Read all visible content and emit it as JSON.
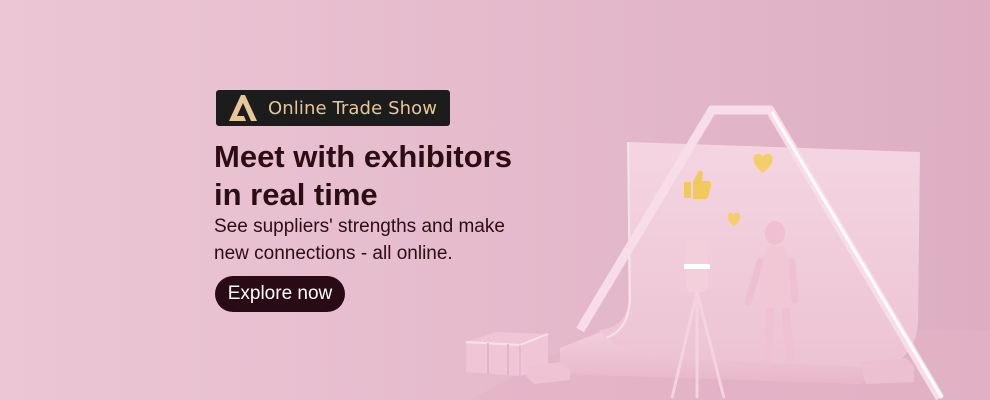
{
  "badge": {
    "label": "Online Trade Show",
    "logo_icon": "alibaba-a-logo-icon"
  },
  "headline": {
    "line1": "Meet with exhibitors",
    "line2": "in real time"
  },
  "subtext": {
    "line1": "See suppliers' strengths and make",
    "line2": "new connections - all online."
  },
  "cta": {
    "label": "Explore now"
  },
  "illustration": {
    "icons": [
      "thumbs-up-icon",
      "heart-icon",
      "camera-on-tripod",
      "figure-mannequin",
      "photo-backdrop",
      "boxes"
    ]
  },
  "colors": {
    "background": "#e6bccd",
    "headline_text": "#2b0d14",
    "badge_background": "#1c1c1c",
    "badge_text": "#e7c697",
    "cta_background": "#2a0a14",
    "cta_text": "#ffffff"
  }
}
